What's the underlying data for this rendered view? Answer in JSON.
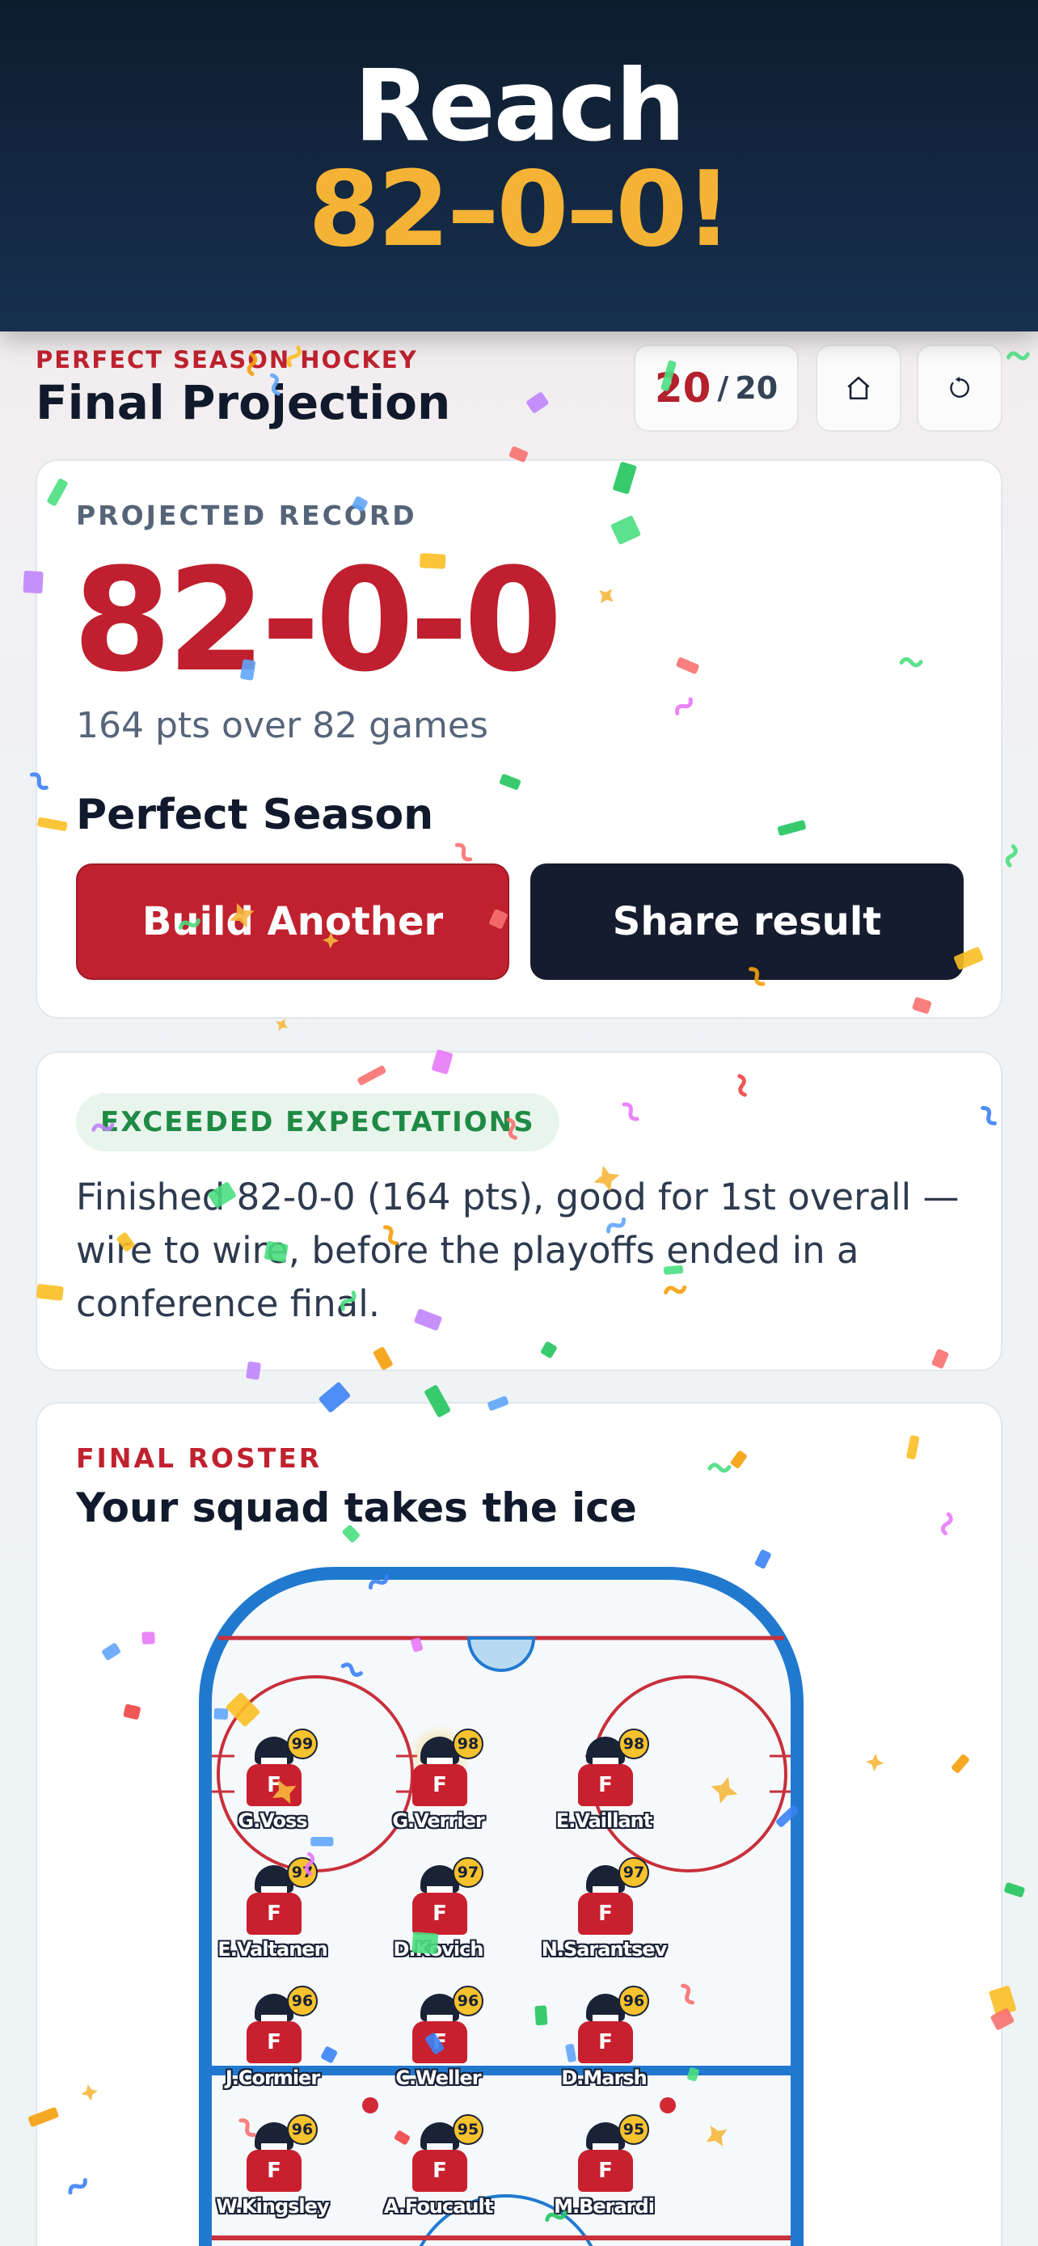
{
  "hero": {
    "line1": "Reach",
    "line2": "82–0–0!"
  },
  "header": {
    "brand": "PERFECT SEASON HOCKEY",
    "title": "Final Projection",
    "progress_current": "20",
    "progress_separator": "/",
    "progress_total": "20",
    "home_icon": "home-icon",
    "restart_icon": "restart-icon"
  },
  "projection": {
    "label": "PROJECTED RECORD",
    "record": "82-0-0",
    "points_line": "164 pts over 82 games",
    "season_title": "Perfect Season",
    "build_button": "Build Another",
    "share_button": "Share result"
  },
  "summary": {
    "badge": "EXCEEDED EXPECTATIONS",
    "text": "Finished 82-0-0 (164 pts), good for 1st overall — wire to wire, before the playoffs ended in a conference final."
  },
  "roster": {
    "label": "FINAL ROSTER",
    "title": "Your squad takes the ice",
    "players": [
      {
        "name": "G.Voss",
        "position": "F",
        "rating": "99"
      },
      {
        "name": "G.Verrier",
        "position": "F",
        "rating": "98",
        "highlight": true
      },
      {
        "name": "E.Vaillant",
        "position": "F",
        "rating": "98"
      },
      {
        "name": "E.Valtanen",
        "position": "F",
        "rating": "97"
      },
      {
        "name": "D.Kovich",
        "position": "F",
        "rating": "97"
      },
      {
        "name": "N.Sarantsev",
        "position": "F",
        "rating": "97"
      },
      {
        "name": "J.Cormier",
        "position": "F",
        "rating": "96"
      },
      {
        "name": "C.Weller",
        "position": "F",
        "rating": "96"
      },
      {
        "name": "D.Marsh",
        "position": "F",
        "rating": "96"
      },
      {
        "name": "W.Kingsley",
        "position": "F",
        "rating": "96"
      },
      {
        "name": "A.Foucault",
        "position": "F",
        "rating": "95"
      },
      {
        "name": "M.Berardi",
        "position": "F",
        "rating": "95"
      }
    ]
  },
  "colors": {
    "accent_red": "#c0212f",
    "gold": "#f5b335",
    "navy": "#141c2e",
    "rink_blue": "#1f7fd1",
    "success_green": "#1f8a44"
  }
}
